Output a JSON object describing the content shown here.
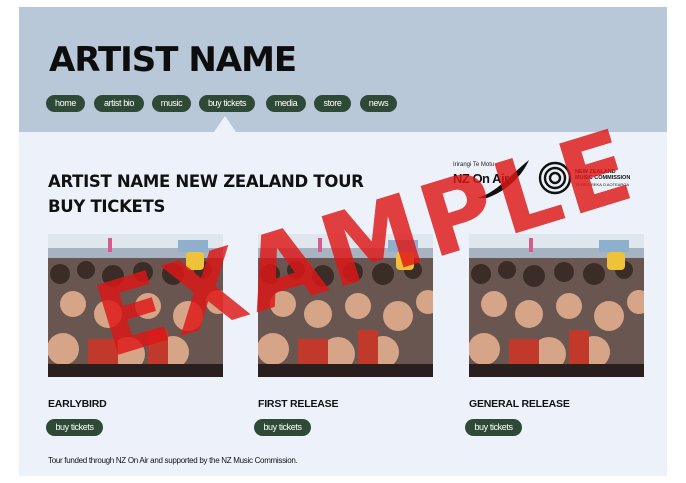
{
  "site": {
    "title": "ARTIST NAME"
  },
  "nav": {
    "items": [
      {
        "label": "home"
      },
      {
        "label": "artist bio"
      },
      {
        "label": "music"
      },
      {
        "label": "buy tickets"
      },
      {
        "label": "media"
      },
      {
        "label": "store"
      },
      {
        "label": "news"
      }
    ],
    "active": "buy tickets"
  },
  "page": {
    "title_line1": "ARTIST NAME NEW ZEALAND TOUR",
    "title_line2": "BUY TICKETS"
  },
  "logos": {
    "nzonair": {
      "small_text": "Irirangi Te Motu",
      "text": "NZ On Air"
    },
    "nzmc": {
      "line1": "NEW ZEALAND",
      "line2": "MUSIC COMMISSION",
      "line3": "TE REO REKA O AOTEAROA"
    }
  },
  "tickets": [
    {
      "title": "EARLYBIRD",
      "button_label": "buy tickets"
    },
    {
      "title": "FIRST RELEASE",
      "button_label": "buy tickets"
    },
    {
      "title": "GENERAL RELEASE",
      "button_label": "buy tickets"
    }
  ],
  "footer": {
    "note": "Tour funded through NZ On Air and supported by the NZ Music Commission."
  },
  "watermark": "EXAMPLE",
  "colors": {
    "header_bg": "#b8c8d9",
    "page_bg": "#edf2fa",
    "pill": "#2e4a36",
    "watermark": "#de1616"
  },
  "icons": [
    "nzonair-logo-icon",
    "nzmc-logo-icon",
    "caret-up-icon"
  ]
}
